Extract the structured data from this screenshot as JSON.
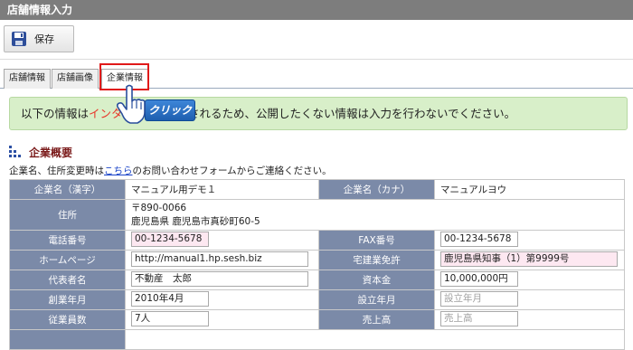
{
  "window": {
    "title": "店舗情報入力"
  },
  "toolbar": {
    "save_label": "保存"
  },
  "tabs": [
    {
      "label": "店舗情報"
    },
    {
      "label": "店舗画像"
    },
    {
      "label": "企業情報"
    }
  ],
  "notice": {
    "text_before": "以下の情報は",
    "text_red": "インタ",
    "text_red2": "開",
    "text_after": "されるため、公開したくない情報は入力を行わないでください。",
    "click_badge": "クリック"
  },
  "section": {
    "title": "企業概要",
    "subnote_before": "企業名、住所変更時は",
    "subnote_link": "こちら",
    "subnote_after": "のお問い合わせフォームからご連絡ください。"
  },
  "form": {
    "company_name_label": "企業名（漢字）",
    "company_name": "マニュアル用デモ１",
    "company_kana_label": "企業名（カナ）",
    "company_kana": "マニュアルヨウ",
    "address_label": "住所",
    "postal": "〒890-0066",
    "address": "鹿児島県 鹿児島市真砂町60-5",
    "phone_label": "電話番号",
    "phone": "00-1234-5678",
    "fax_label": "FAX番号",
    "fax": "00-1234-5678",
    "homepage_label": "ホームページ",
    "homepage": "http://manual1.hp.sesh.biz",
    "license_label": "宅建業免許",
    "license": "鹿児島県知事（1）第9999号",
    "rep_label": "代表者名",
    "rep": "不動産　太郎",
    "capital_label": "資本金",
    "capital": "10,000,000円",
    "founded_label": "創業年月",
    "founded": "2010年4月",
    "established_label": "設立年月",
    "established_placeholder": "設立年月",
    "employees_label": "従業員数",
    "employees": "7人",
    "sales_label": "売上高",
    "sales_placeholder": "売上高"
  }
}
